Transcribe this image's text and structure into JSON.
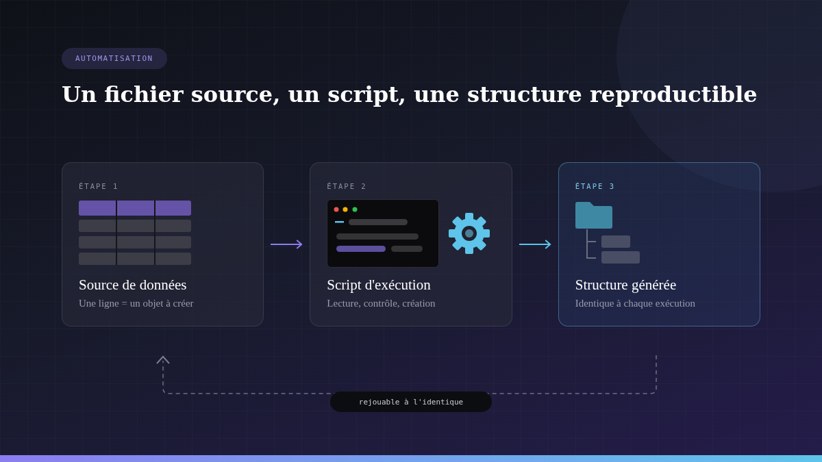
{
  "badge": "AUTOMATISATION",
  "title": "Un fichier source, un script, une structure reproductible",
  "steps": [
    {
      "label": "ÉTAPE 1",
      "kind": "table",
      "title": "Source de données",
      "subtitle": "Une ligne = un objet à créer",
      "highlighted": false
    },
    {
      "label": "ÉTAPE 2",
      "kind": "terminal",
      "title": "Script d'exécution",
      "subtitle": "Lecture, contrôle, création",
      "highlighted": false
    },
    {
      "label": "ÉTAPE 3",
      "kind": "tree",
      "title": "Structure générée",
      "subtitle": "Identique à chaque exécution",
      "highlighted": true
    }
  ],
  "loop": {
    "label": "rejouable à l'identique"
  }
}
